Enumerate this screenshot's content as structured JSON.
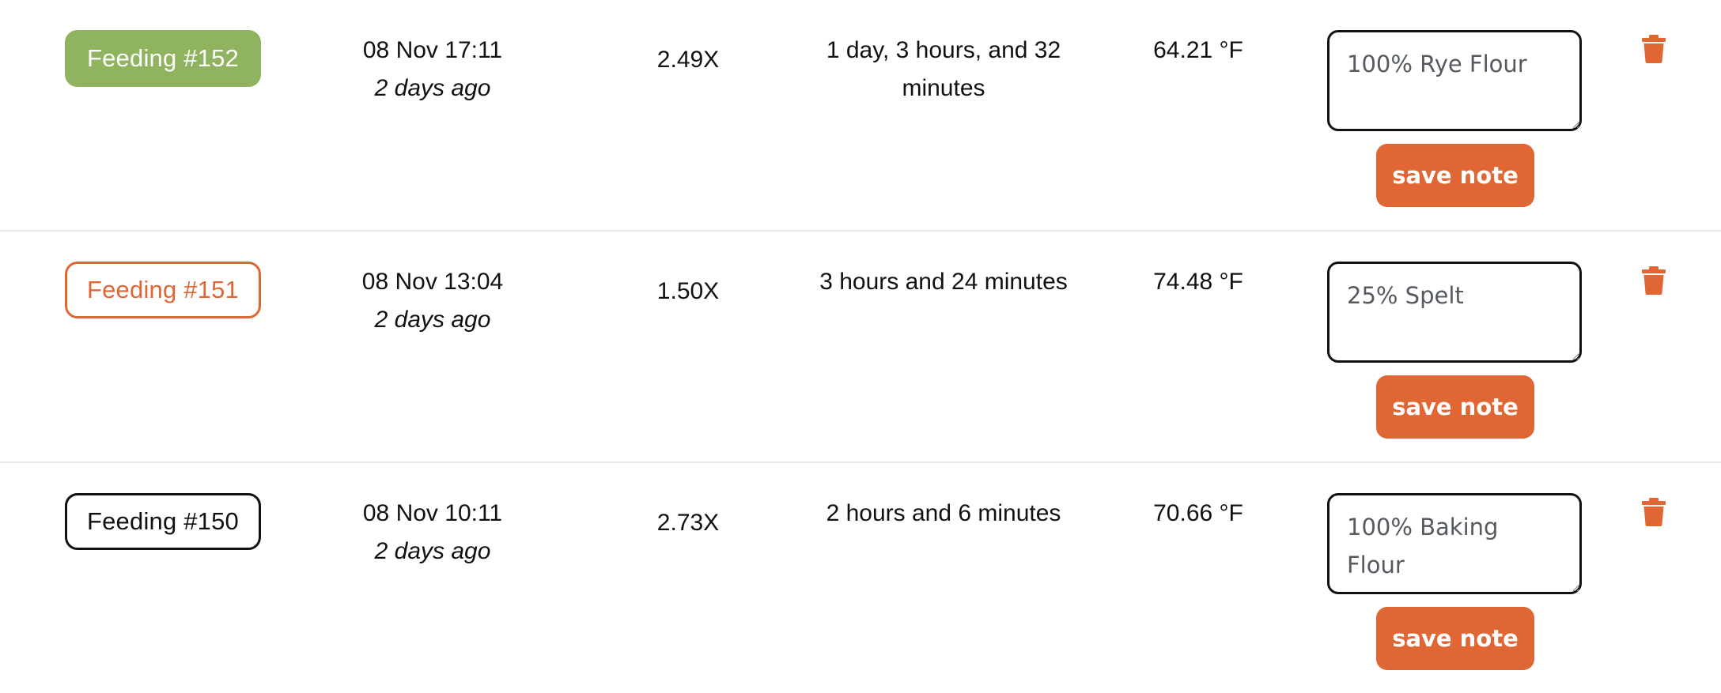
{
  "colors": {
    "green_badge": "#8fb35f",
    "orange_accent": "#e06733",
    "text": "#111111",
    "note_text": "#555a61",
    "divider": "#e8e8e8"
  },
  "feedings": [
    {
      "label": "Feeding #152",
      "badge_style": "filled-green",
      "date": "08 Nov 17:11",
      "relative": "2 days ago",
      "ratio": "2.49X",
      "duration": "1 day, 3 hours, and 32 minutes",
      "temperature": "64.21 °F",
      "note": "100% Rye Flour",
      "save_label": "save note",
      "delete_icon": "trash-icon"
    },
    {
      "label": "Feeding #151",
      "badge_style": "outline-orange",
      "date": "08 Nov 13:04",
      "relative": "2 days ago",
      "ratio": "1.50X",
      "duration": "3 hours and 24 minutes",
      "temperature": "74.48 °F",
      "note": "25% Spelt",
      "save_label": "save note",
      "delete_icon": "trash-icon"
    },
    {
      "label": "Feeding #150",
      "badge_style": "outline-black",
      "date": "08 Nov 10:11",
      "relative": "2 days ago",
      "ratio": "2.73X",
      "duration": "2 hours and 6 minutes",
      "temperature": "70.66 °F",
      "note": "100% Baking Flour",
      "save_label": "save note",
      "delete_icon": "trash-icon"
    }
  ]
}
